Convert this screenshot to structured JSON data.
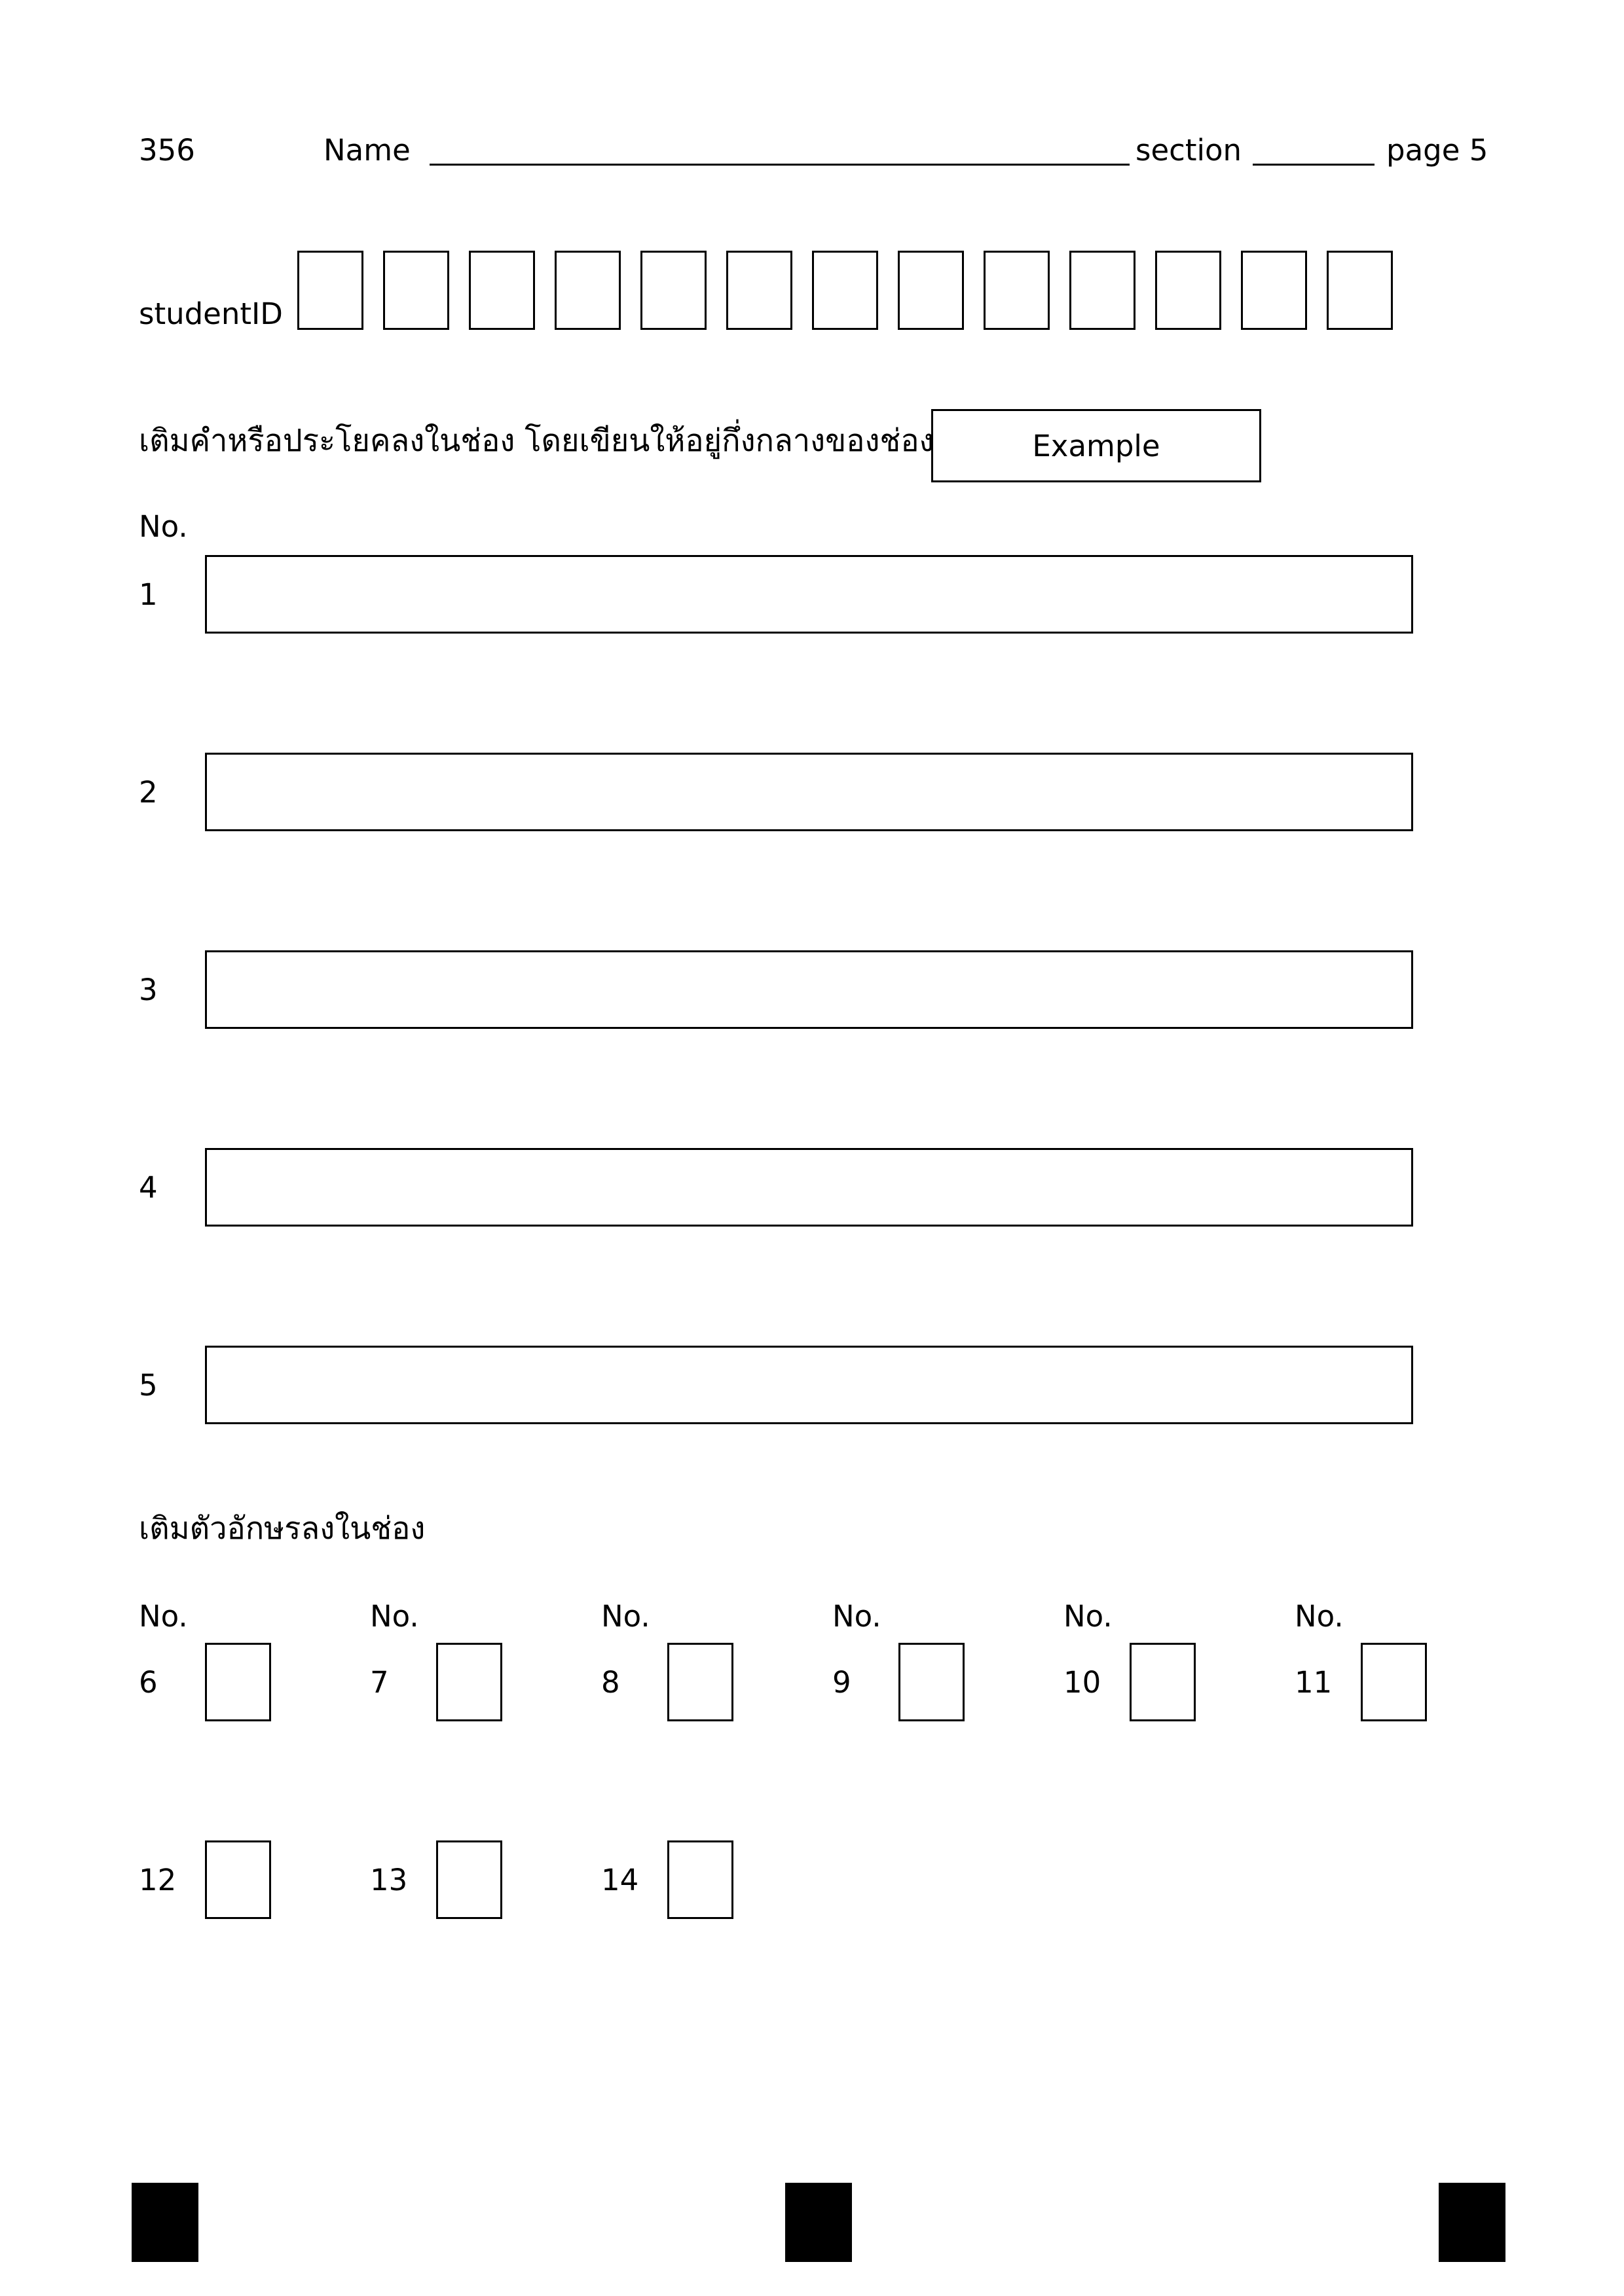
{
  "header": {
    "course_code": "356",
    "name_label": "Name",
    "section_label": "section",
    "page_label": "page 5"
  },
  "student_id": {
    "label": "studentID",
    "box_count": 13
  },
  "fill_words": {
    "instruction": "เติมคำหรือประโยคลงในช่อง โดยเขียนให้อยู่กึ่งกลางของช่อง เช่น",
    "example_text": "Example",
    "no_label": "No.",
    "items": [
      "1",
      "2",
      "3",
      "4",
      "5"
    ]
  },
  "fill_letters": {
    "instruction": "เติมตัวอักษรลงในช่อง",
    "no_label": "No.",
    "row1": [
      "6",
      "7",
      "8",
      "9",
      "10",
      "11"
    ],
    "row2": [
      "12",
      "13",
      "14"
    ]
  }
}
